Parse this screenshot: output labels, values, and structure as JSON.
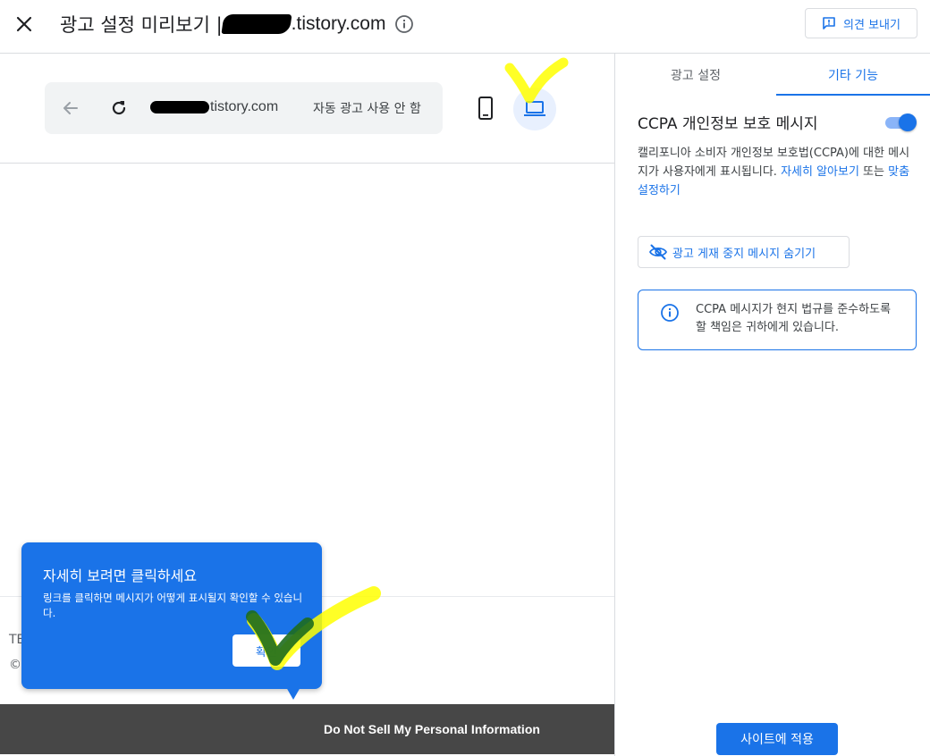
{
  "header": {
    "title_prefix": "광고 설정 미리보기 |",
    "title_domain": ".tistory.com",
    "feedback_label": "의견 보내기"
  },
  "preview": {
    "url_text": "tistory.com",
    "auto_ads_status": "자동 광고 사용 안 함",
    "footer_line1": "TE",
    "footer_line2": "©",
    "ccpa_bar_link": "Do Not Sell My Personal Information"
  },
  "tooltip": {
    "title": "자세히 보려면 클릭하세요",
    "body": "링크를 클릭하면 메시지가 어떻게 표시될지 확인할 수 있습니다.",
    "ok_label": "확인"
  },
  "panel": {
    "tabs": [
      {
        "label": "광고 설정"
      },
      {
        "label": "기타 기능"
      }
    ],
    "selected_tab": "기타 기능",
    "ccpa_title": "CCPA 개인정보 보호 메시지",
    "ccpa_toggle_on": true,
    "desc_text": "캘리포니아 소비자 개인정보 보호법(CCPA)에 대한 메시지가 사용자에게 표시됩니다. ",
    "learn_more_link": "자세히 알아보기",
    "desc_or": " 또는 ",
    "customize_link": "맞춤설정하기",
    "hide_msg_label": "광고 게재 중지 메시지 숨기기",
    "notice_text": "CCPA 메시지가 현지 법규를 준수하도록 할 책임은 귀하에게 있습니다.",
    "apply_label": "사이트에 적용"
  },
  "colors": {
    "accent": "#1a73e8",
    "ccpa_bar": "#474747",
    "annotation_yellow": "#ffff00",
    "annotation_green": "#1e6b1e"
  }
}
